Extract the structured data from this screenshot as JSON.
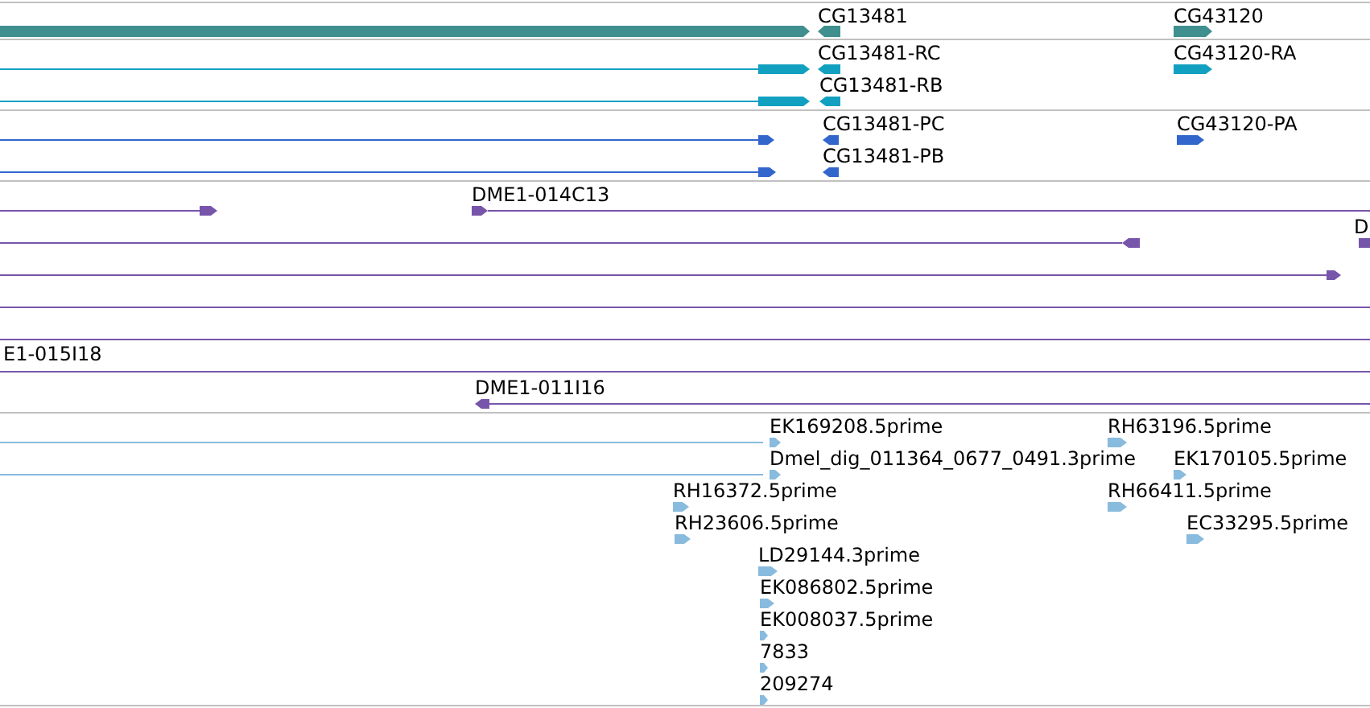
{
  "tracks": [
    {
      "features": [
        {
          "label": "CG13481"
        },
        {
          "label": "CG43120"
        }
      ]
    },
    {
      "features": [
        {
          "label": "CG13481-RC"
        },
        {
          "label": "CG13481-RB"
        },
        {
          "label": "CG43120-RA"
        }
      ]
    },
    {
      "features": [
        {
          "label": "CG13481-PC"
        },
        {
          "label": "CG13481-PB"
        },
        {
          "label": "CG43120-PA"
        }
      ]
    },
    {
      "features": [
        {
          "label": "DME1-014C13"
        },
        {
          "label": "D"
        },
        {
          "label": "E1-015I18"
        },
        {
          "label": "DME1-011I16"
        }
      ]
    },
    {
      "features": [
        {
          "label": "EK169208.5prime"
        },
        {
          "label": "Dmel_dig_011364_0677_0491.3prime"
        },
        {
          "label": "RH16372.5prime"
        },
        {
          "label": "RH23606.5prime"
        },
        {
          "label": "LD29144.3prime"
        },
        {
          "label": "EK086802.5prime"
        },
        {
          "label": "EK008037.5prime"
        },
        {
          "label": "7833"
        },
        {
          "label": "209274"
        },
        {
          "label": "RH63196.5prime"
        },
        {
          "label": "EK170105.5prime"
        },
        {
          "label": "RH66411.5prime"
        },
        {
          "label": "EC33295.5prime"
        }
      ]
    }
  ]
}
